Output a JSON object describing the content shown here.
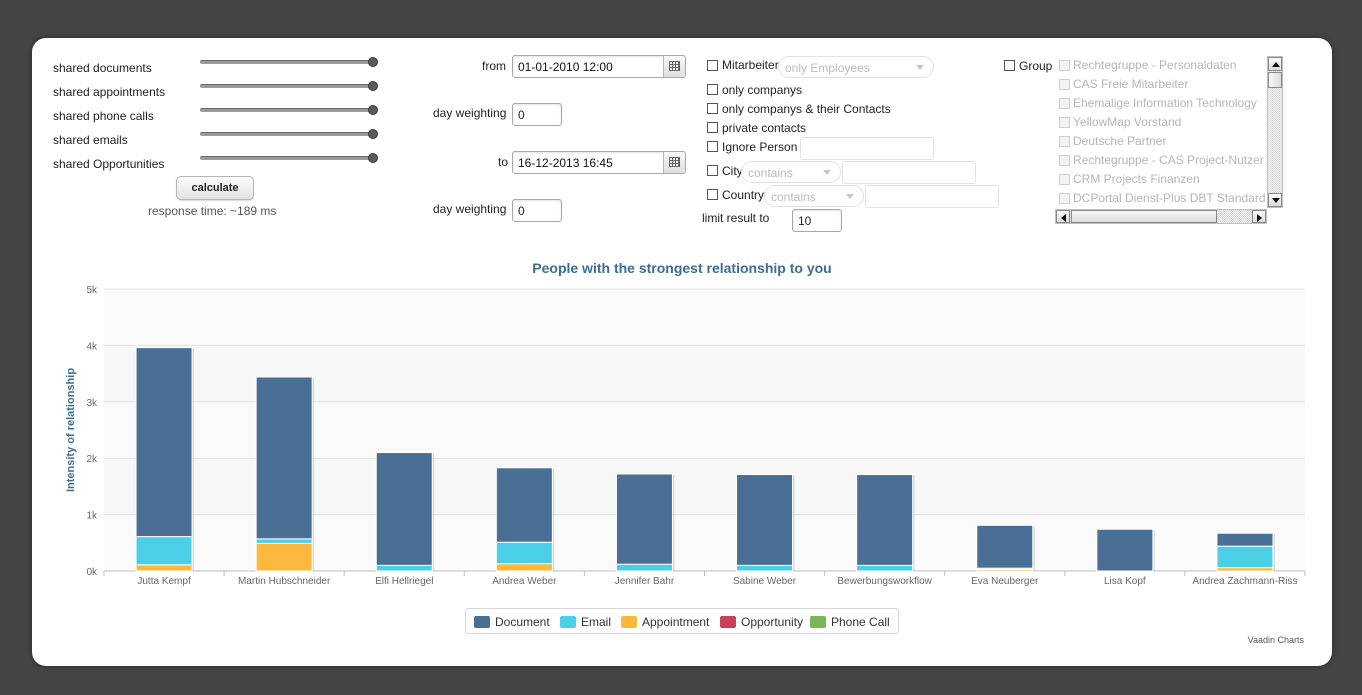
{
  "sliders": [
    {
      "label": "shared documents",
      "value": 1.0
    },
    {
      "label": "shared appointments",
      "value": 1.0
    },
    {
      "label": "shared phone calls",
      "value": 1.0
    },
    {
      "label": "shared emails",
      "value": 1.0
    },
    {
      "label": "shared Opportunities",
      "value": 1.0
    }
  ],
  "calculate": {
    "label": "calculate",
    "response_time": "response time: ~189 ms"
  },
  "date_range": {
    "from_label": "from",
    "from_value": "01-01-2010 12:00",
    "from_weight_label": "day weighting",
    "from_weight_value": "0",
    "to_label": "to",
    "to_value": "16-12-2013 16:45",
    "to_weight_label": "day weighting",
    "to_weight_value": "0"
  },
  "filters": {
    "mitarbeiter_label": "Mitarbeiter",
    "mitarbeiter_select": "only Employees",
    "only_companys": "only companys",
    "only_companys_contacts": "only companys & their Contacts",
    "private_contacts": "private contacts",
    "ignore_person": "Ignore Person",
    "city_label": "City",
    "city_op": "contains",
    "country_label": "Country",
    "country_op": "contains",
    "limit_label": "limit result to",
    "limit_value": "10"
  },
  "group": {
    "label": "Group",
    "items": [
      "Rechtegruppe - Personaldaten",
      "CAS Freie Mitarbeiter",
      "Ehemalige Information Technology",
      "YellowMap Vorstand",
      "Deutsche Partner",
      "Rechtegruppe - CAS Project-Nutzer",
      "CRM Projects Finanzen",
      "DCPortal Dienst-Plus DBT Standard"
    ]
  },
  "colors": {
    "Document": "#4a6f94",
    "Email": "#4bcfe6",
    "Appointment": "#fbb83c",
    "Opportunity": "#c8405a",
    "Phone Call": "#7cb45a",
    "title": "#3e6d93"
  },
  "chart_data": {
    "type": "bar",
    "stacked": true,
    "title": "People with the strongest relationship to you",
    "ylabel": "Intensity of relationship",
    "ylim": [
      0,
      5000
    ],
    "yticks": [
      "0k",
      "1k",
      "2k",
      "3k",
      "4k",
      "5k"
    ],
    "categories": [
      "Jutta Kempf",
      "Martin Hubschneider",
      "Elfi Hellriegel",
      "Andrea Weber",
      "Jennifer Bahr",
      "Sabine Weber",
      "Bewerbungsworkflow",
      "Eva Neuberger",
      "Lisa Kopf",
      "Andrea Zachmann-Riss"
    ],
    "series": [
      {
        "name": "Document",
        "values": [
          3350,
          2870,
          2000,
          1320,
          1600,
          1610,
          1610,
          760,
          740,
          230
        ]
      },
      {
        "name": "Email",
        "values": [
          500,
          80,
          100,
          380,
          120,
          100,
          100,
          20,
          0,
          380
        ]
      },
      {
        "name": "Appointment",
        "values": [
          110,
          490,
          0,
          130,
          0,
          0,
          0,
          30,
          0,
          60
        ]
      },
      {
        "name": "Opportunity",
        "values": [
          0,
          0,
          0,
          0,
          0,
          0,
          0,
          0,
          0,
          0
        ]
      },
      {
        "name": "Phone Call",
        "values": [
          0,
          0,
          0,
          0,
          0,
          0,
          0,
          0,
          0,
          0
        ]
      }
    ],
    "legend": "bottom-center",
    "credit": "Vaadin Charts"
  }
}
